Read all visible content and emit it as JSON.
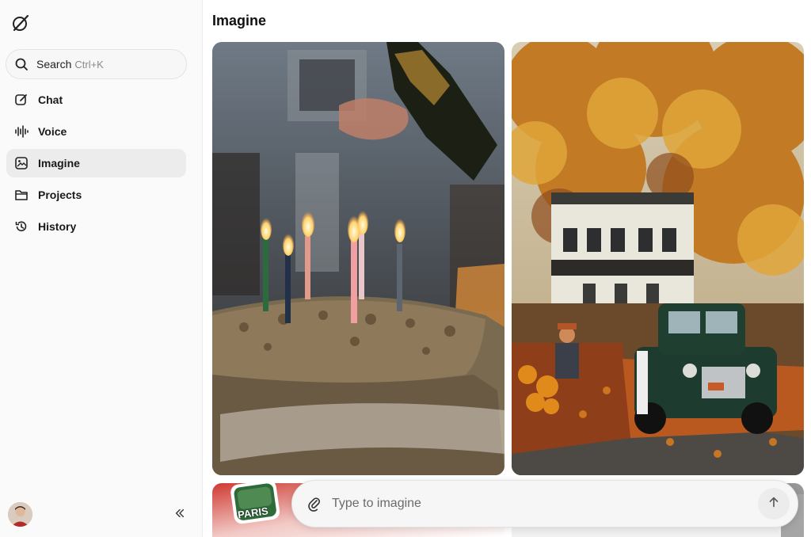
{
  "app": {
    "page_title": "Imagine"
  },
  "search": {
    "label": "Search",
    "shortcut": "Ctrl+K"
  },
  "nav": [
    {
      "label": "Chat",
      "icon": "pencil-square-icon"
    },
    {
      "label": "Voice",
      "icon": "waveform-icon"
    },
    {
      "label": "Imagine",
      "icon": "image-icon",
      "active": true
    },
    {
      "label": "Projects",
      "icon": "folder-icon"
    },
    {
      "label": "History",
      "icon": "history-icon"
    }
  ],
  "gallery": [
    {
      "subject": "birthday cake with lit candles and champagne"
    },
    {
      "subject": "autumn house with vintage green truck"
    },
    {
      "subject": "Paris sticker"
    },
    {
      "subject": "white background image"
    }
  ],
  "gallery_sticker_text": "PARIS",
  "prompt": {
    "placeholder": "Type to imagine"
  },
  "colors": {
    "accent_active_bg": "#ececec",
    "sidebar_bg": "#fafafa"
  }
}
